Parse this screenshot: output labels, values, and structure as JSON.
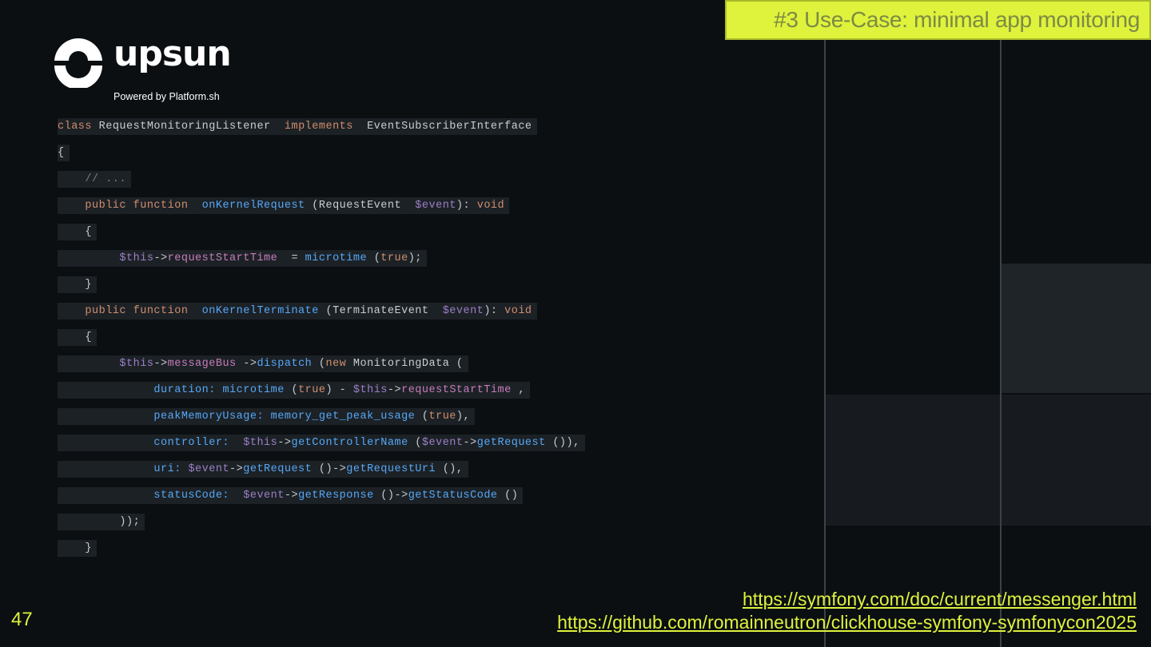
{
  "slide": {
    "title": "#3 Use-Case: minimal app monitoring",
    "page_number": "47"
  },
  "logo": {
    "wordmark": "upsun",
    "tagline": "Powered by Platform.sh"
  },
  "code": {
    "language": "php",
    "lines": [
      [
        [
          "kw",
          "class"
        ],
        [
          "pl",
          " RequestMonitoringListener "
        ],
        [
          "kw",
          " implements "
        ],
        [
          "pl",
          " EventSubscriberInterface"
        ]
      ],
      [
        [
          "pl",
          "{"
        ]
      ],
      [
        [
          "pl",
          "    "
        ],
        [
          "cm",
          "// ..."
        ]
      ],
      [
        [
          "pl",
          "    "
        ],
        [
          "kw",
          "public"
        ],
        [
          "pl",
          " "
        ],
        [
          "kw",
          "function"
        ],
        [
          "pl",
          "  "
        ],
        [
          "fn",
          "onKernelRequest"
        ],
        [
          "pl",
          " (RequestEvent  "
        ],
        [
          "var",
          "$event"
        ],
        [
          "pl",
          "): "
        ],
        [
          "kw",
          "void"
        ]
      ],
      [
        [
          "pl",
          "    {"
        ]
      ],
      [
        [
          "pl",
          "         "
        ],
        [
          "var",
          "$this"
        ],
        [
          "pl",
          "->"
        ],
        [
          "prop",
          "requestStartTime"
        ],
        [
          "pl",
          "  = "
        ],
        [
          "fn",
          "microtime"
        ],
        [
          "pl",
          " ("
        ],
        [
          "kw",
          "true"
        ],
        [
          "pl",
          ");"
        ]
      ],
      [
        [
          "pl",
          "    }"
        ]
      ],
      [
        [
          "pl",
          "    "
        ],
        [
          "kw",
          "public"
        ],
        [
          "pl",
          " "
        ],
        [
          "kw",
          "function"
        ],
        [
          "pl",
          "  "
        ],
        [
          "fn",
          "onKernelTerminate"
        ],
        [
          "pl",
          " (TerminateEvent  "
        ],
        [
          "var",
          "$event"
        ],
        [
          "pl",
          "): "
        ],
        [
          "kw",
          "void"
        ]
      ],
      [
        [
          "pl",
          "    {"
        ]
      ],
      [
        [
          "pl",
          "         "
        ],
        [
          "var",
          "$this"
        ],
        [
          "pl",
          "->"
        ],
        [
          "prop",
          "messageBus"
        ],
        [
          "pl",
          " ->"
        ],
        [
          "fn",
          "dispatch"
        ],
        [
          "pl",
          " ("
        ],
        [
          "kw",
          "new"
        ],
        [
          "pl",
          " MonitoringData ("
        ]
      ],
      [
        [
          "pl",
          "              "
        ],
        [
          "fn",
          "duration:"
        ],
        [
          "pl",
          " "
        ],
        [
          "fn",
          "microtime"
        ],
        [
          "pl",
          " ("
        ],
        [
          "kw",
          "true"
        ],
        [
          "pl",
          ") - "
        ],
        [
          "var",
          "$this"
        ],
        [
          "pl",
          "->"
        ],
        [
          "prop",
          "requestStartTime"
        ],
        [
          "pl",
          " ,"
        ]
      ],
      [
        [
          "pl",
          "              "
        ],
        [
          "fn",
          "peakMemoryUsage:"
        ],
        [
          "pl",
          " "
        ],
        [
          "fn",
          "memory_get_peak_usage"
        ],
        [
          "pl",
          " ("
        ],
        [
          "kw",
          "true"
        ],
        [
          "pl",
          "),"
        ]
      ],
      [
        [
          "pl",
          "              "
        ],
        [
          "fn",
          "controller:"
        ],
        [
          "pl",
          "  "
        ],
        [
          "var",
          "$this"
        ],
        [
          "pl",
          "->"
        ],
        [
          "fn",
          "getControllerName"
        ],
        [
          "pl",
          " ("
        ],
        [
          "var",
          "$event"
        ],
        [
          "pl",
          "->"
        ],
        [
          "fn",
          "getRequest"
        ],
        [
          "pl",
          " ()),"
        ]
      ],
      [
        [
          "pl",
          "              "
        ],
        [
          "fn",
          "uri:"
        ],
        [
          "pl",
          " "
        ],
        [
          "var",
          "$event"
        ],
        [
          "pl",
          "->"
        ],
        [
          "fn",
          "getRequest"
        ],
        [
          "pl",
          " ()->"
        ],
        [
          "fn",
          "getRequestUri"
        ],
        [
          "pl",
          " (),"
        ]
      ],
      [
        [
          "pl",
          "              "
        ],
        [
          "fn",
          "statusCode:"
        ],
        [
          "pl",
          "  "
        ],
        [
          "var",
          "$event"
        ],
        [
          "pl",
          "->"
        ],
        [
          "fn",
          "getResponse"
        ],
        [
          "pl",
          " ()->"
        ],
        [
          "fn",
          "getStatusCode"
        ],
        [
          "pl",
          " ()"
        ]
      ],
      [
        [
          "pl",
          "         ));"
        ]
      ],
      [
        [
          "pl",
          "    }"
        ]
      ]
    ]
  },
  "links": [
    "https://symfony.com/doc/current/messenger.html",
    "https://github.com/romainneutron/clickhouse-symfony-symfonycon2025"
  ],
  "colors": {
    "accent": "#dff23c",
    "background": "#0b0f12",
    "code_keyword": "#cf8e6d",
    "code_function": "#56a8f5",
    "code_variable": "#9c7fc6",
    "code_property": "#c77dbb"
  }
}
